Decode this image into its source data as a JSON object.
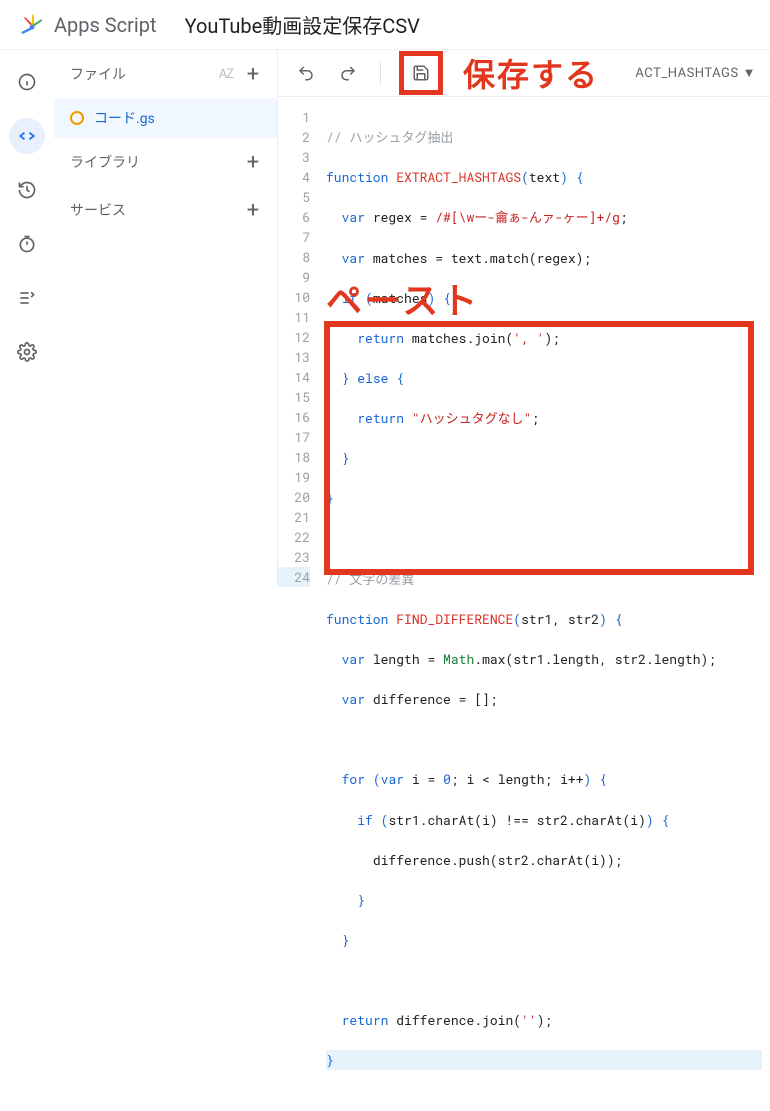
{
  "header": {
    "app_title": "Apps Script",
    "project_title": "YouTube動画設定保存CSV"
  },
  "sidebar": {
    "files_label": "ファイル",
    "sort_label": "AZ",
    "file_name": "コード.gs",
    "libraries_label": "ライブラリ",
    "services_label": "サービス"
  },
  "toolbar": {
    "function_label": "ACT_HASHTAGS"
  },
  "annotations": {
    "save": "保存する",
    "paste": "ペースト"
  },
  "code": {
    "line1": "// ハッシュタグ抽出",
    "line2_fn": "EXTRACT_HASHTAGS",
    "line2_param": "text",
    "line3_var": "regex",
    "line3_re": "/#[\\wー-龠ぁ-んァ-ヶー]+/g",
    "line4_var": "matches",
    "line4_expr": "text.match(regex)",
    "line5_cond": "matches",
    "line6_expr": "matches.join",
    "line6_str": "', '",
    "line8_str": "\"ハッシュタグなし\"",
    "line12": "// 文字の差異",
    "line13_fn": "FIND_DIFFERENCE",
    "line13_p1": "str1",
    "line13_p2": "str2",
    "line14_var": "length",
    "line14_math": "Math",
    "line14_expr": ".max(str1.length, str2.length)",
    "line15_var": "difference",
    "line17_i": "i",
    "line17_zero": "0",
    "line17_cond": "i < length",
    "line17_inc": "i++",
    "line18_cond": "str1.charAt(i) !== str2.charAt(i)",
    "line19_expr": "difference.push(str2.charAt(i))",
    "line23_expr": "difference.join",
    "line23_str": "''"
  }
}
